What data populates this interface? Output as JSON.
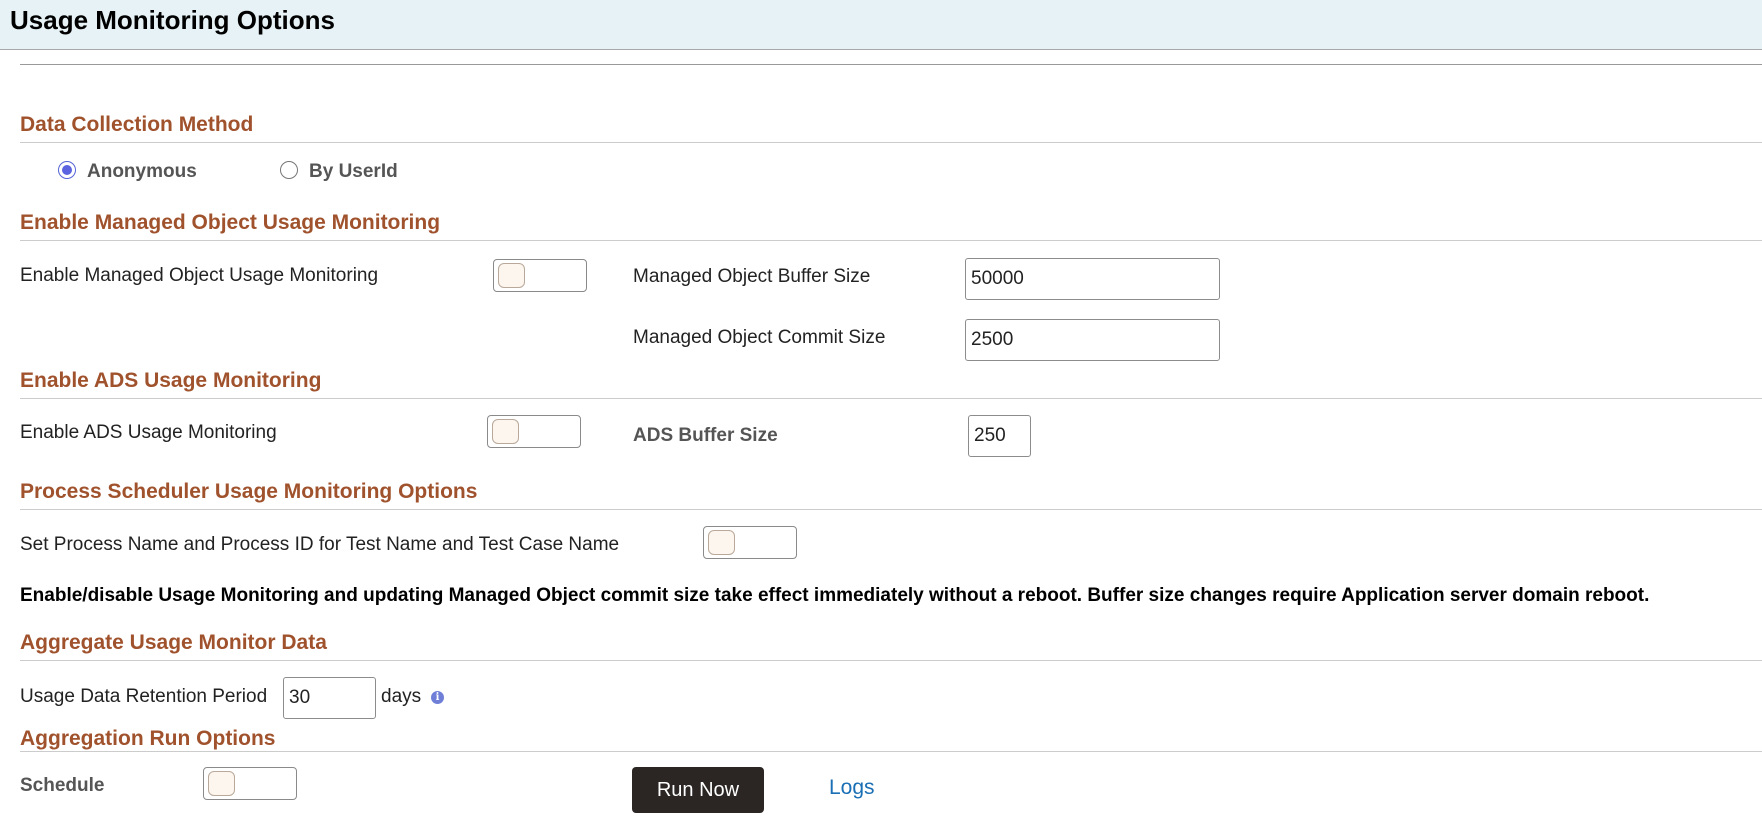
{
  "page": {
    "title": "Usage Monitoring Options"
  },
  "data_collection": {
    "title": "Data Collection Method",
    "options": [
      {
        "label": "Anonymous",
        "selected": true
      },
      {
        "label": "By UserId",
        "selected": false
      }
    ]
  },
  "managed_object": {
    "title": "Enable Managed Object Usage Monitoring",
    "enable_label": "Enable Managed Object Usage Monitoring",
    "enabled": false,
    "buffer_label": "Managed Object Buffer Size",
    "buffer_value": "50000",
    "commit_label": "Managed Object Commit Size",
    "commit_value": "2500"
  },
  "ads": {
    "title": "Enable ADS Usage Monitoring",
    "enable_label": "Enable ADS Usage Monitoring",
    "enabled": false,
    "buffer_label": "ADS Buffer Size",
    "buffer_value": "250"
  },
  "process_scheduler": {
    "title": "Process Scheduler Usage Monitoring Options",
    "set_label": "Set Process Name and Process ID for Test Name and Test Case Name",
    "enabled": false
  },
  "note": "Enable/disable Usage Monitoring and updating Managed Object commit size take effect immediately without a reboot. Buffer size changes require Application server domain reboot.",
  "aggregate": {
    "title": "Aggregate Usage Monitor Data",
    "retention_label": "Usage Data Retention Period",
    "retention_value": "30",
    "retention_unit": "days",
    "info_icon": "info-icon"
  },
  "run_options": {
    "title": "Aggregation Run Options",
    "schedule_label": "Schedule",
    "schedule_enabled": false,
    "run_now_label": "Run Now",
    "logs_label": "Logs"
  },
  "colors": {
    "section_title": "#a0522d",
    "header_bg": "#e6f2f5",
    "run_button_bg": "#2b2624",
    "link": "#1a6fb5",
    "radio_selected": "#5b63e0"
  }
}
